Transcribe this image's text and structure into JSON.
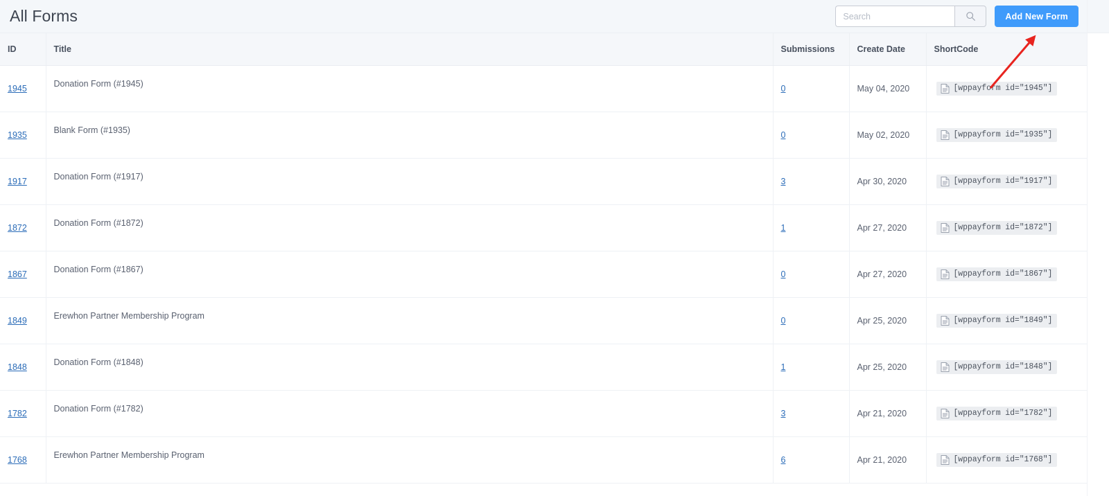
{
  "header": {
    "title": "All Forms",
    "search": {
      "placeholder": "Search",
      "value": "",
      "icon": "search-icon"
    },
    "add_button": {
      "label": "Add New Form"
    }
  },
  "table": {
    "columns": [
      "ID",
      "Title",
      "Submissions",
      "Create Date",
      "ShortCode"
    ],
    "shortcode_icon": "document-icon",
    "rows": [
      {
        "id": "1945",
        "title": "Donation Form (#1945)",
        "submissions": "0",
        "create_date": "May 04, 2020",
        "shortcode": "[wppayform id=\"1945\"]"
      },
      {
        "id": "1935",
        "title": "Blank Form (#1935)",
        "submissions": "0",
        "create_date": "May 02, 2020",
        "shortcode": "[wppayform id=\"1935\"]"
      },
      {
        "id": "1917",
        "title": "Donation Form (#1917)",
        "submissions": "3",
        "create_date": "Apr 30, 2020",
        "shortcode": "[wppayform id=\"1917\"]"
      },
      {
        "id": "1872",
        "title": "Donation Form (#1872)",
        "submissions": "1",
        "create_date": "Apr 27, 2020",
        "shortcode": "[wppayform id=\"1872\"]"
      },
      {
        "id": "1867",
        "title": "Donation Form (#1867)",
        "submissions": "0",
        "create_date": "Apr 27, 2020",
        "shortcode": "[wppayform id=\"1867\"]"
      },
      {
        "id": "1849",
        "title": "Erewhon Partner Membership Program",
        "submissions": "0",
        "create_date": "Apr 25, 2020",
        "shortcode": "[wppayform id=\"1849\"]"
      },
      {
        "id": "1848",
        "title": "Donation Form (#1848)",
        "submissions": "1",
        "create_date": "Apr 25, 2020",
        "shortcode": "[wppayform id=\"1848\"]"
      },
      {
        "id": "1782",
        "title": "Donation Form (#1782)",
        "submissions": "3",
        "create_date": "Apr 21, 2020",
        "shortcode": "[wppayform id=\"1782\"]"
      },
      {
        "id": "1768",
        "title": "Erewhon Partner Membership Program",
        "submissions": "6",
        "create_date": "Apr 21, 2020",
        "shortcode": "[wppayform id=\"1768\"]"
      }
    ]
  },
  "annotation": {
    "type": "arrow",
    "color": "#e8241f",
    "points_to": "add-new-form-button"
  },
  "colors": {
    "accent": "#3f9bfb",
    "link": "#2b6cb8",
    "header_bg": "#f4f7fa",
    "table_head_bg": "#f5f7fa",
    "annotation_red": "#e8241f"
  }
}
